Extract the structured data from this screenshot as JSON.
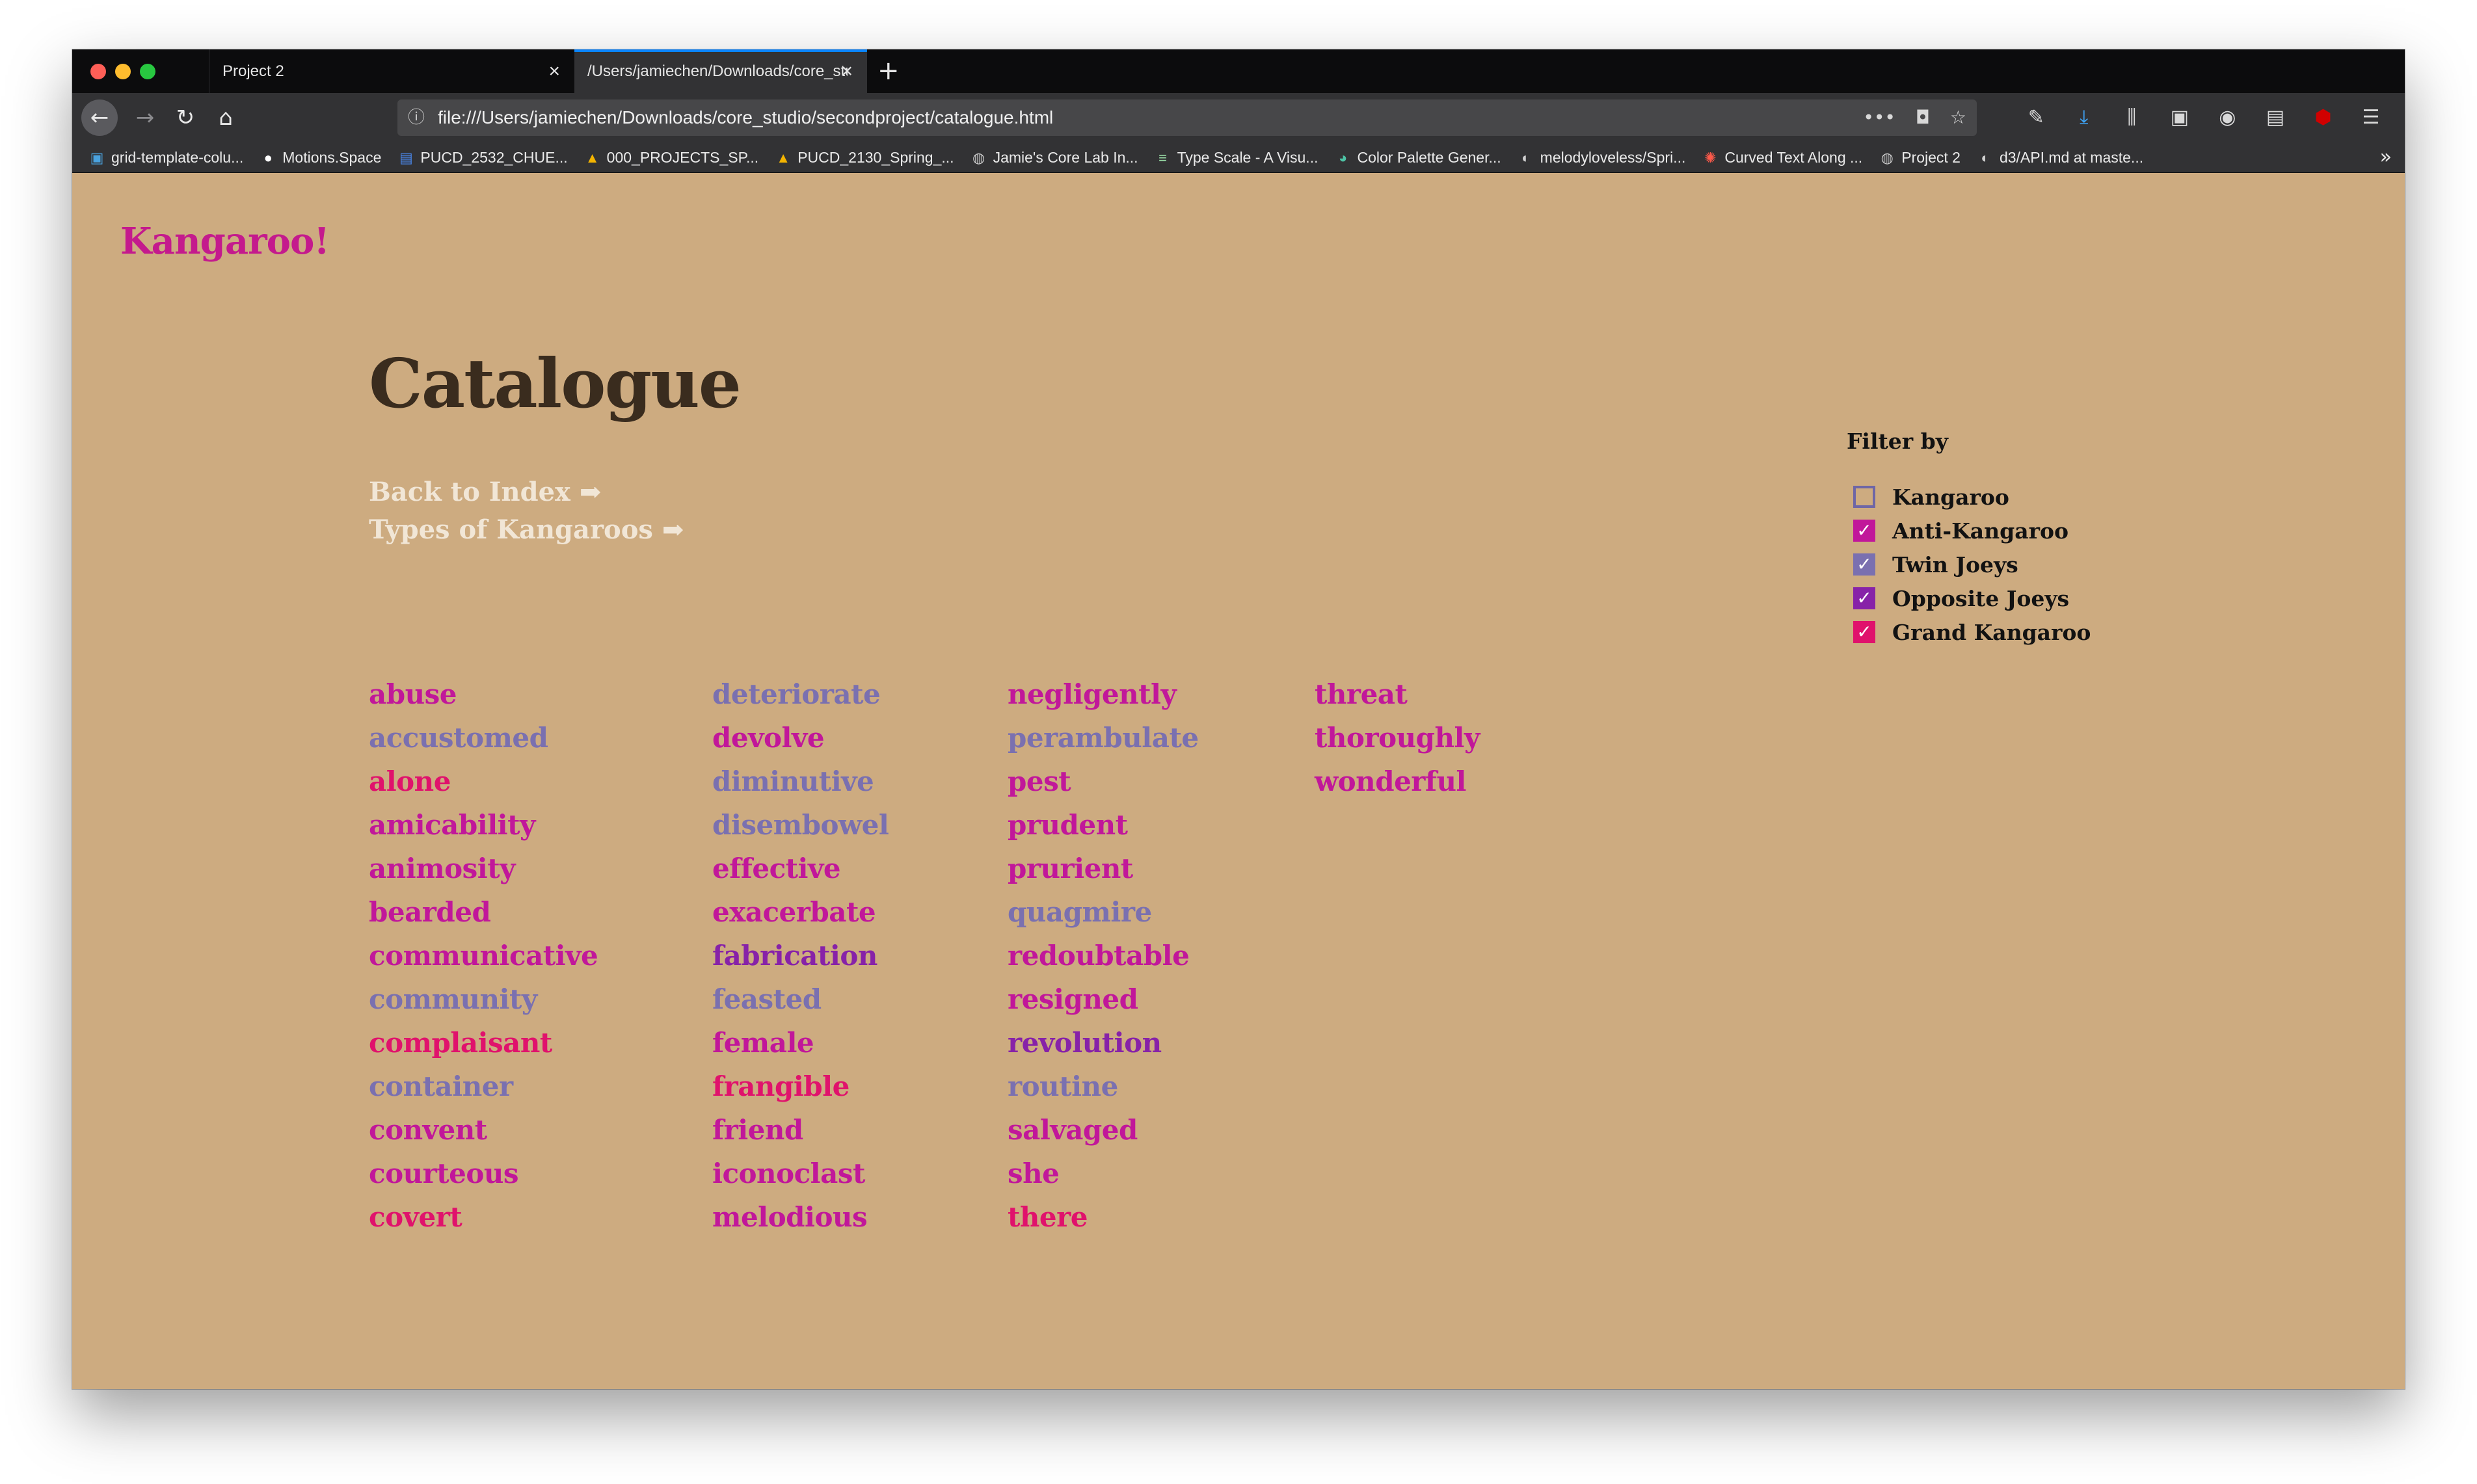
{
  "browser": {
    "tabs": [
      {
        "title": "Project 2",
        "active": false
      },
      {
        "title": "/Users/jamiechen/Downloads/core_studio/secondproject/catalogue.html",
        "active": true
      }
    ],
    "url": "file:///Users/jamiechen/Downloads/core_studio/secondproject/catalogue.html",
    "bookmarks": [
      {
        "label": "grid-template-colu...",
        "icon": "image-icon"
      },
      {
        "label": "Motions.Space",
        "icon": "circle-icon"
      },
      {
        "label": "PUCD_2532_CHUE...",
        "icon": "doc-icon"
      },
      {
        "label": "000_PROJECTS_SP...",
        "icon": "drive-icon"
      },
      {
        "label": "PUCD_2130_Spring_...",
        "icon": "drive-icon"
      },
      {
        "label": "Jamie's Core Lab In...",
        "icon": "globe-icon"
      },
      {
        "label": "Type Scale - A Visu...",
        "icon": "lines-icon"
      },
      {
        "label": "Color Palette Gener...",
        "icon": "palette-icon"
      },
      {
        "label": "melodyloveless/Spri...",
        "icon": "github-icon"
      },
      {
        "label": "Curved Text Along ...",
        "icon": "codepen-icon"
      },
      {
        "label": "Project 2",
        "icon": "globe-icon"
      },
      {
        "label": "d3/API.md at maste...",
        "icon": "github-icon"
      }
    ]
  },
  "page": {
    "logo": "Kangaroo!",
    "title": "Catalogue",
    "links": [
      {
        "label": "Back to Index"
      },
      {
        "label": "Types of Kangaroos"
      }
    ]
  },
  "filter": {
    "title": "Filter by",
    "options": [
      {
        "label": "Kangaroo",
        "checked": false,
        "color": "#6e66a6"
      },
      {
        "label": "Anti-Kangaroo",
        "checked": true,
        "color": "#c1179a"
      },
      {
        "label": "Twin Joeys",
        "checked": true,
        "color": "#7a70b0"
      },
      {
        "label": "Opposite Joeys",
        "checked": true,
        "color": "#8722a8"
      },
      {
        "label": "Grand Kangaroo",
        "checked": true,
        "color": "#e0126c"
      }
    ]
  },
  "words": [
    {
      "text": "abuse",
      "type": "anti"
    },
    {
      "text": "accustomed",
      "type": "twin"
    },
    {
      "text": "alone",
      "type": "grand"
    },
    {
      "text": "amicability",
      "type": "anti"
    },
    {
      "text": "animosity",
      "type": "anti"
    },
    {
      "text": "bearded",
      "type": "anti"
    },
    {
      "text": "communicative",
      "type": "anti"
    },
    {
      "text": "community",
      "type": "twin"
    },
    {
      "text": "complaisant",
      "type": "grand"
    },
    {
      "text": "container",
      "type": "twin"
    },
    {
      "text": "convent",
      "type": "anti"
    },
    {
      "text": "courteous",
      "type": "anti"
    },
    {
      "text": "covert",
      "type": "grand"
    },
    {
      "text": "deteriorate",
      "type": "twin"
    },
    {
      "text": "devolve",
      "type": "anti"
    },
    {
      "text": "diminutive",
      "type": "twin"
    },
    {
      "text": "disembowel",
      "type": "twin"
    },
    {
      "text": "effective",
      "type": "anti"
    },
    {
      "text": "exacerbate",
      "type": "anti"
    },
    {
      "text": "fabrication",
      "type": "opp"
    },
    {
      "text": "feasted",
      "type": "twin"
    },
    {
      "text": "female",
      "type": "anti"
    },
    {
      "text": "frangible",
      "type": "grand"
    },
    {
      "text": "friend",
      "type": "anti"
    },
    {
      "text": "iconoclast",
      "type": "anti"
    },
    {
      "text": "melodious",
      "type": "anti"
    },
    {
      "text": "negligently",
      "type": "anti"
    },
    {
      "text": "perambulate",
      "type": "twin"
    },
    {
      "text": "pest",
      "type": "anti"
    },
    {
      "text": "prudent",
      "type": "anti"
    },
    {
      "text": "prurient",
      "type": "anti"
    },
    {
      "text": "quagmire",
      "type": "twin"
    },
    {
      "text": "redoubtable",
      "type": "anti"
    },
    {
      "text": "resigned",
      "type": "anti"
    },
    {
      "text": "revolution",
      "type": "opp"
    },
    {
      "text": "routine",
      "type": "twin"
    },
    {
      "text": "salvaged",
      "type": "anti"
    },
    {
      "text": "she",
      "type": "anti"
    },
    {
      "text": "there",
      "type": "grand"
    },
    {
      "text": "threat",
      "type": "anti"
    },
    {
      "text": "thoroughly",
      "type": "anti"
    },
    {
      "text": "wonderful",
      "type": "anti"
    }
  ]
}
